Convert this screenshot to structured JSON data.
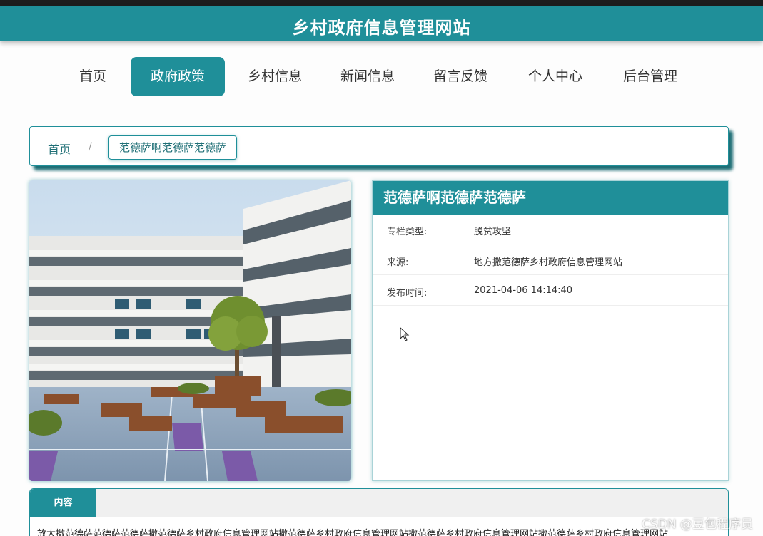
{
  "header": {
    "title": "乡村政府信息管理网站"
  },
  "nav": {
    "items": [
      {
        "label": "首页"
      },
      {
        "label": "政府政策"
      },
      {
        "label": "乡村信息"
      },
      {
        "label": "新闻信息"
      },
      {
        "label": "留言反馈"
      },
      {
        "label": "个人中心"
      },
      {
        "label": "后台管理"
      }
    ],
    "active": "政府政策"
  },
  "breadcrumb": {
    "home": "首页",
    "separator": "/",
    "current": "范德萨啊范德萨范德萨"
  },
  "detail": {
    "title": "范德萨啊范德萨范德萨",
    "rows": [
      {
        "label": "专栏类型:",
        "value": "脱贫攻坚"
      },
      {
        "label": "来源:",
        "value": "地方撒范德萨乡村政府信息管理网站"
      },
      {
        "label": "发布时间:",
        "value": "2021-04-06 14:14:40"
      }
    ]
  },
  "content": {
    "tab_label": "内容",
    "text": "放大撒范德萨范德萨范德萨撒范德萨乡村政府信息管理网站撒范德萨乡村政府信息管理网站撒范德萨乡村政府信息管理网站撒范德萨乡村政府信息管理网站"
  },
  "watermark": "CSDN @豆包程序员",
  "colors": {
    "primary": "#1f8f99",
    "dark_teal": "#1f6f76",
    "top_strip": "#1d1d1d"
  }
}
